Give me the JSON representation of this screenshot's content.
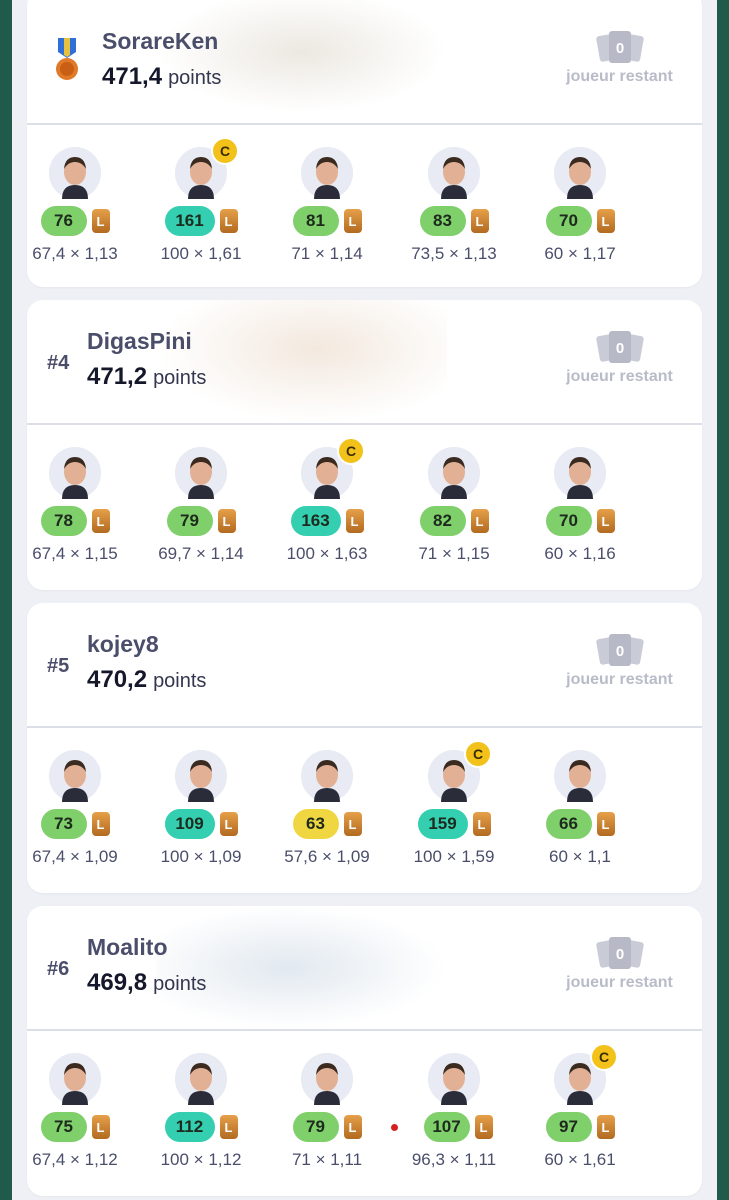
{
  "rank_word": "joueur restant",
  "points_word": "points",
  "captain_badge": "C",
  "level_badge": "L",
  "colors": {
    "green": "#7fcf6b",
    "teal": "#33cfb0",
    "yellow": "#f0d640",
    "captain": "#f2c21a",
    "level": "#c8802e"
  },
  "entries": [
    {
      "rank": "",
      "medal": "medal-icon",
      "name": "SorareKen",
      "score": "471,4",
      "remaining": "0",
      "players": [
        {
          "score": "76",
          "color": "green",
          "formula": "67,4 × 1,13",
          "captain": false
        },
        {
          "score": "161",
          "color": "teal",
          "formula": "100 × 1,61",
          "captain": true
        },
        {
          "score": "81",
          "color": "green",
          "formula": "71 × 1,14",
          "captain": false
        },
        {
          "score": "83",
          "color": "green",
          "formula": "73,5 × 1,13",
          "captain": false
        },
        {
          "score": "70",
          "color": "green",
          "formula": "60 × 1,17",
          "captain": false
        }
      ]
    },
    {
      "rank": "#4",
      "name": "DigasPini",
      "score": "471,2",
      "remaining": "0",
      "players": [
        {
          "score": "78",
          "color": "green",
          "formula": "67,4 × 1,15",
          "captain": false
        },
        {
          "score": "79",
          "color": "green",
          "formula": "69,7 × 1,14",
          "captain": false
        },
        {
          "score": "163",
          "color": "teal",
          "formula": "100 × 1,63",
          "captain": true
        },
        {
          "score": "82",
          "color": "green",
          "formula": "71 × 1,15",
          "captain": false
        },
        {
          "score": "70",
          "color": "green",
          "formula": "60 × 1,16",
          "captain": false
        }
      ]
    },
    {
      "rank": "#5",
      "name": "kojey8",
      "score": "470,2",
      "remaining": "0",
      "players": [
        {
          "score": "73",
          "color": "green",
          "formula": "67,4 × 1,09",
          "captain": false
        },
        {
          "score": "109",
          "color": "teal",
          "formula": "100 × 1,09",
          "captain": false
        },
        {
          "score": "63",
          "color": "yellow",
          "formula": "57,6 × 1,09",
          "captain": false
        },
        {
          "score": "159",
          "color": "teal",
          "formula": "100 × 1,59",
          "captain": true
        },
        {
          "score": "66",
          "color": "green",
          "formula": "60 × 1,1",
          "captain": false
        }
      ]
    },
    {
      "rank": "#6",
      "name": "Moalito",
      "score": "469,8",
      "remaining": "0",
      "players": [
        {
          "score": "75",
          "color": "green",
          "formula": "67,4 × 1,12",
          "captain": false
        },
        {
          "score": "112",
          "color": "teal",
          "formula": "100 × 1,12",
          "captain": false
        },
        {
          "score": "79",
          "color": "green",
          "formula": "71 × 1,11",
          "captain": false
        },
        {
          "score": "107",
          "color": "green",
          "formula": "96,3 × 1,11",
          "captain": false,
          "red_dot": true
        },
        {
          "score": "97",
          "color": "green",
          "formula": "60 × 1,61",
          "captain": true
        }
      ]
    }
  ]
}
